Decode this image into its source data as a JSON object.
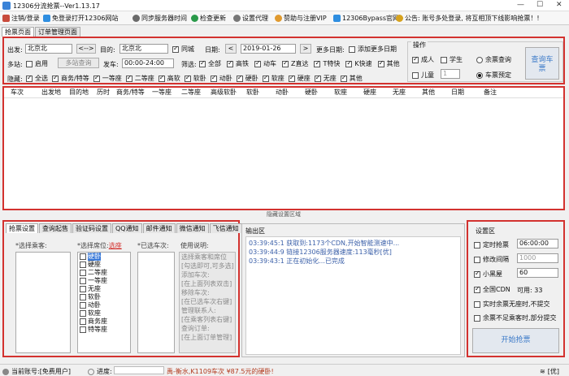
{
  "window": {
    "title": "12306分流抢票--Ver1.13.17",
    "min": "—",
    "max": "☐",
    "close": "✕"
  },
  "toolbar": {
    "items": [
      "注销/登录",
      "免登录打开12306网站",
      "同步服务器时间",
      "检查更新",
      "设置代理",
      "赞助与注册VIP",
      "12306Bypass官网"
    ],
    "notice": "公告: 账号多处登录, 将互相顶下线影响抢票！!"
  },
  "tabs": [
    "抢票页面",
    "订单管理页面"
  ],
  "query": {
    "from_label": "出发:",
    "from_value": "北京北",
    "swap": "<-->",
    "to_label": "目的:",
    "to_value": "北京北",
    "same_city": "同城",
    "date_label": "日期:",
    "date_value": "2019-01-26",
    "prev": "<",
    "next": ">",
    "more_dates": "更多日期:",
    "add_more_dates": "添加更多日期",
    "multi_station": "多站:",
    "enable": "启用",
    "multi_btn": "多站查询",
    "depart": "发车:",
    "depart_value": "00:00-24:00",
    "filter": "筛选:",
    "filters": [
      "全部",
      "高铁",
      "动车",
      "Z直达",
      "T特快",
      "K快速",
      "其他"
    ],
    "hide": "隐藏:",
    "hide_items": [
      "全选",
      "商务/特等",
      "一等座",
      "二等座",
      "高软",
      "软卧",
      "动卧",
      "硬卧",
      "软座",
      "硬座",
      "无座",
      "其他"
    ],
    "ops_label": "操作",
    "adult": "成人",
    "student": "学生",
    "child": "儿童",
    "child_count": "1",
    "remain_query": "余票查询",
    "book_mode": "车票预定",
    "query_btn": "查询车票"
  },
  "table": {
    "headers": [
      "车次",
      "出发地",
      "目的地",
      "历时",
      "商务/特等",
      "一等座",
      "二等座",
      "高级软卧",
      "软卧",
      "动卧",
      "硬卧",
      "软座",
      "硬座",
      "无座",
      "其他",
      "日期",
      "备注"
    ]
  },
  "hide_settings": "隐藏设置区域",
  "settings_tabs": [
    "抢票设置",
    "查询起售",
    "验证码设置",
    "QQ通知",
    "邮件通知",
    "微信通知",
    "飞信通知"
  ],
  "settings": {
    "passenger_label": "*选择乘客:",
    "seat_label": "*选择席位:",
    "seat_link": "选座",
    "train_label": "*已选车次:",
    "help_label": "使用说明:",
    "seats": [
      "硬卧",
      "硬座",
      "二等座",
      "一等座",
      "无座",
      "软卧",
      "动卧",
      "软座",
      "商务座",
      "特等座"
    ],
    "help_lines": [
      "选择乘客和席位",
      "[勾选即可,可多选]",
      "添加车次:",
      "[在上面列表双击]",
      "移除车次:",
      "[在已选车次右键]",
      "管理联系人:",
      "[在乘客列表右键]",
      "查询订单:",
      "[在上面订单管理]"
    ]
  },
  "output": {
    "label": "输出区",
    "lines": [
      "03:39:45:1  获取到:1173个CDN,开始智能测速中...",
      "03:39:44:9  链接12306服务器速度:113毫秒[优]",
      "03:39:43:1  正在初始化...已完成"
    ]
  },
  "config": {
    "label": "设置区",
    "timed": "定时抢票",
    "timed_value": "06:00:00",
    "interval": "修改间隔",
    "interval_value": "1000",
    "blackroom": "小黑屋",
    "blackroom_value": "60",
    "cdn": "全国CDN",
    "cdn_avail": "可用:  33",
    "realtime": "实时余票无座时,不提交",
    "partial": "余票不足乘客时,部分提交",
    "start_btn": "开始抢票"
  },
  "status": {
    "account": "当前账号:[免费用户]",
    "progress": "进度:",
    "ticker": "禹-衡水,K1109车次 ¥87.5元的硬卧!",
    "right": "[优]"
  }
}
